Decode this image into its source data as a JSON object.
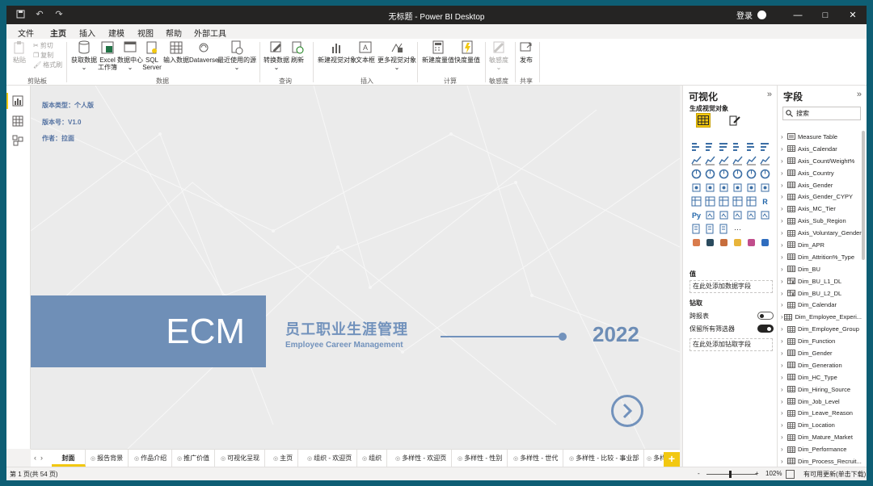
{
  "window": {
    "title": "无标题 - Power BI Desktop",
    "login": "登录",
    "controls": [
      "—",
      "□",
      "✕"
    ]
  },
  "menu": {
    "tabs": [
      {
        "label": "文件",
        "active": false
      },
      {
        "label": "主页",
        "active": true
      },
      {
        "label": "插入",
        "active": false
      },
      {
        "label": "建模",
        "active": false
      },
      {
        "label": "视图",
        "active": false
      },
      {
        "label": "帮助",
        "active": false
      },
      {
        "label": "外部工具",
        "active": false
      }
    ]
  },
  "ribbon": {
    "clipboard": {
      "paste": "粘贴",
      "cut": "剪切",
      "copy": "复制",
      "format_painter": "格式刷",
      "group": "剪贴板"
    },
    "data": {
      "get_data": "获取数据",
      "excel": "Excel 工作簿",
      "datahub": "数据中心",
      "sql": "SQL Server",
      "enter_data": "输入数据",
      "dataverse": "Dataverse",
      "recent": "最近使用的源",
      "group": "数据"
    },
    "queries": {
      "transform": "转换数据",
      "refresh": "刷新",
      "group": "查询"
    },
    "insert": {
      "new_visual": "新建视觉对象",
      "textbox": "文本框",
      "more_visuals": "更多视觉对象",
      "group": "插入"
    },
    "calc": {
      "new_measure": "新建度量值",
      "quick_measure": "快度量值",
      "group": "计算"
    },
    "sensitivity": {
      "label": "敏感度",
      "group": "敏感度"
    },
    "share": {
      "publish": "发布",
      "group": "共享"
    }
  },
  "report": {
    "edition": "版本类型：个人版",
    "version": "版本号：V1.0",
    "author": "作者：拉面",
    "logo": "ECM",
    "title_cn": "员工职业生涯管理",
    "title_en": "Employee Career Management",
    "year": "2022"
  },
  "pages": {
    "tabs": [
      {
        "label": "封面",
        "active": true
      },
      {
        "label": "报告背景",
        "active": false
      },
      {
        "label": "作品介绍",
        "active": false
      },
      {
        "label": "推广价值",
        "active": false
      },
      {
        "label": "可视化呈现",
        "active": false
      },
      {
        "label": "主页",
        "active": false
      },
      {
        "label": "组织 - 欢迎页",
        "active": false
      },
      {
        "label": "组织",
        "active": false
      },
      {
        "label": "多样性 - 欢迎页",
        "active": false
      },
      {
        "label": "多样性 - 性别",
        "active": false
      },
      {
        "label": "多样性 - 世代",
        "active": false
      },
      {
        "label": "多样性 - 比较 - 事业部",
        "active": false
      },
      {
        "label": "多样",
        "active": false
      }
    ],
    "add": "+"
  },
  "status": {
    "page": "第 1 页(共 54 页)",
    "zoom_minus": "-",
    "zoom_plus": "+",
    "zoom": "102%",
    "update": "有可用更新(单击下载)",
    "zoom_level": 0.47
  },
  "viz_pane": {
    "title": "可视化",
    "build_visual": "生成视觉对象",
    "values_label": "值",
    "values_drop": "在此处添加数据字段",
    "drill_label": "钻取",
    "cross_report": "跨报表",
    "keep_filters": "保留所有筛选器",
    "drill_drop": "在此处添加钻取字段"
  },
  "fields_pane": {
    "title": "字段",
    "search_placeholder": "搜索",
    "items": [
      {
        "name": "Measure Table",
        "icon": "measure-table-icon"
      },
      {
        "name": "Axis_Calendar",
        "icon": "table-icon"
      },
      {
        "name": "Axis_Count/Weight%",
        "icon": "table-icon"
      },
      {
        "name": "Axis_Country",
        "icon": "table-icon"
      },
      {
        "name": "Axis_Gender",
        "icon": "table-icon"
      },
      {
        "name": "Axis_Gender_CYPY",
        "icon": "table-icon"
      },
      {
        "name": "Axis_MC_Tier",
        "icon": "table-icon"
      },
      {
        "name": "Axis_Sub_Region",
        "icon": "table-icon"
      },
      {
        "name": "Axis_Voluntary_Gender",
        "icon": "table-icon"
      },
      {
        "name": "Dim_APR",
        "icon": "table-icon"
      },
      {
        "name": "Dim_Attrition%_Type",
        "icon": "table-icon"
      },
      {
        "name": "Dim_BU",
        "icon": "table-icon"
      },
      {
        "name": "Dim_BU_L1_DL",
        "icon": "calc-table-icon"
      },
      {
        "name": "Dim_BU_L2_DL",
        "icon": "calc-table-icon"
      },
      {
        "name": "Dim_Calendar",
        "icon": "table-icon"
      },
      {
        "name": "Dim_Employee_Experi...",
        "icon": "table-icon"
      },
      {
        "name": "Dim_Employee_Group",
        "icon": "table-icon"
      },
      {
        "name": "Dim_Function",
        "icon": "table-icon"
      },
      {
        "name": "Dim_Gender",
        "icon": "table-icon"
      },
      {
        "name": "Dim_Generation",
        "icon": "table-icon"
      },
      {
        "name": "Dim_HC_Type",
        "icon": "table-icon"
      },
      {
        "name": "Dim_Hiring_Source",
        "icon": "table-icon"
      },
      {
        "name": "Dim_Job_Level",
        "icon": "table-icon"
      },
      {
        "name": "Dim_Leave_Reason",
        "icon": "table-icon"
      },
      {
        "name": "Dim_Location",
        "icon": "table-icon"
      },
      {
        "name": "Dim_Mature_Market",
        "icon": "table-icon"
      },
      {
        "name": "Dim_Performance",
        "icon": "table-icon"
      },
      {
        "name": "Dim_Process_Recruit...",
        "icon": "table-icon"
      }
    ]
  },
  "colors": {
    "accent": "#f2c811",
    "brand_blue": "#6f8fb7",
    "titlebar": "#252423",
    "frame": "#0e5e74"
  }
}
